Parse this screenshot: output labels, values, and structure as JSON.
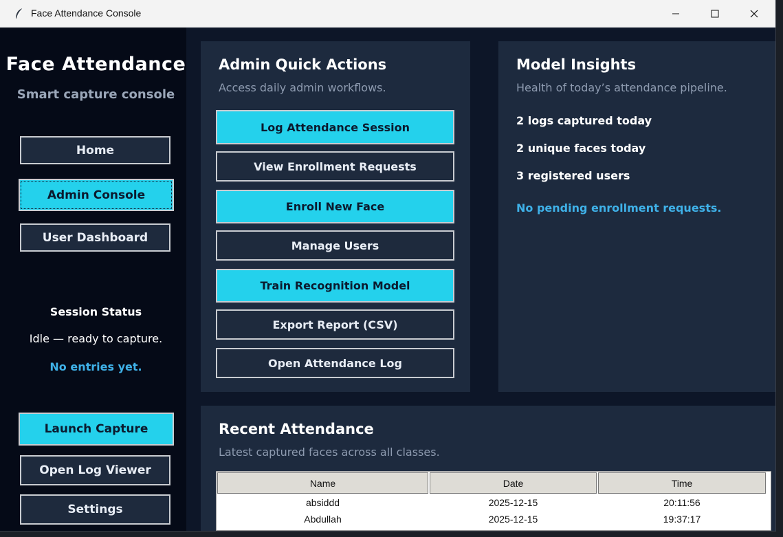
{
  "window": {
    "title": "Face Attendance Console"
  },
  "sidebar": {
    "app_title": "Face Attendance",
    "app_subtitle": "Smart capture console",
    "nav": {
      "home": "Home",
      "admin": "Admin Console",
      "user": "User Dashboard"
    },
    "session": {
      "heading": "Session Status",
      "status": "Idle — ready to capture.",
      "entries": "No entries yet."
    },
    "actions": {
      "launch": "Launch Capture",
      "log_viewer": "Open Log Viewer",
      "settings": "Settings"
    }
  },
  "quick_actions": {
    "title": "Admin Quick Actions",
    "subtitle": "Access daily admin workflows.",
    "buttons": {
      "log_session": "Log Attendance Session",
      "view_requests": "View Enrollment Requests",
      "enroll": "Enroll New Face",
      "manage": "Manage Users",
      "train": "Train Recognition Model",
      "export": "Export Report (CSV)",
      "open_log": "Open Attendance Log"
    }
  },
  "insights": {
    "title": "Model Insights",
    "subtitle": "Health of today’s attendance pipeline.",
    "logs": "2 logs captured today",
    "faces": "2 unique faces today",
    "users": "3 registered users",
    "pending": "No pending enrollment requests."
  },
  "recent": {
    "title": "Recent Attendance",
    "subtitle": "Latest captured faces across all classes.",
    "columns": [
      "Name",
      "Date",
      "Time"
    ],
    "rows": [
      [
        "absiddd",
        "2025-12-15",
        "20:11:56"
      ],
      [
        "Abdullah",
        "2025-12-15",
        "19:37:17"
      ]
    ]
  },
  "colors": {
    "accent": "#24d1ec",
    "background": "#0d1628",
    "card": "#1d2a3e",
    "sidebar": "#050a17",
    "link": "#3fb1e8"
  }
}
